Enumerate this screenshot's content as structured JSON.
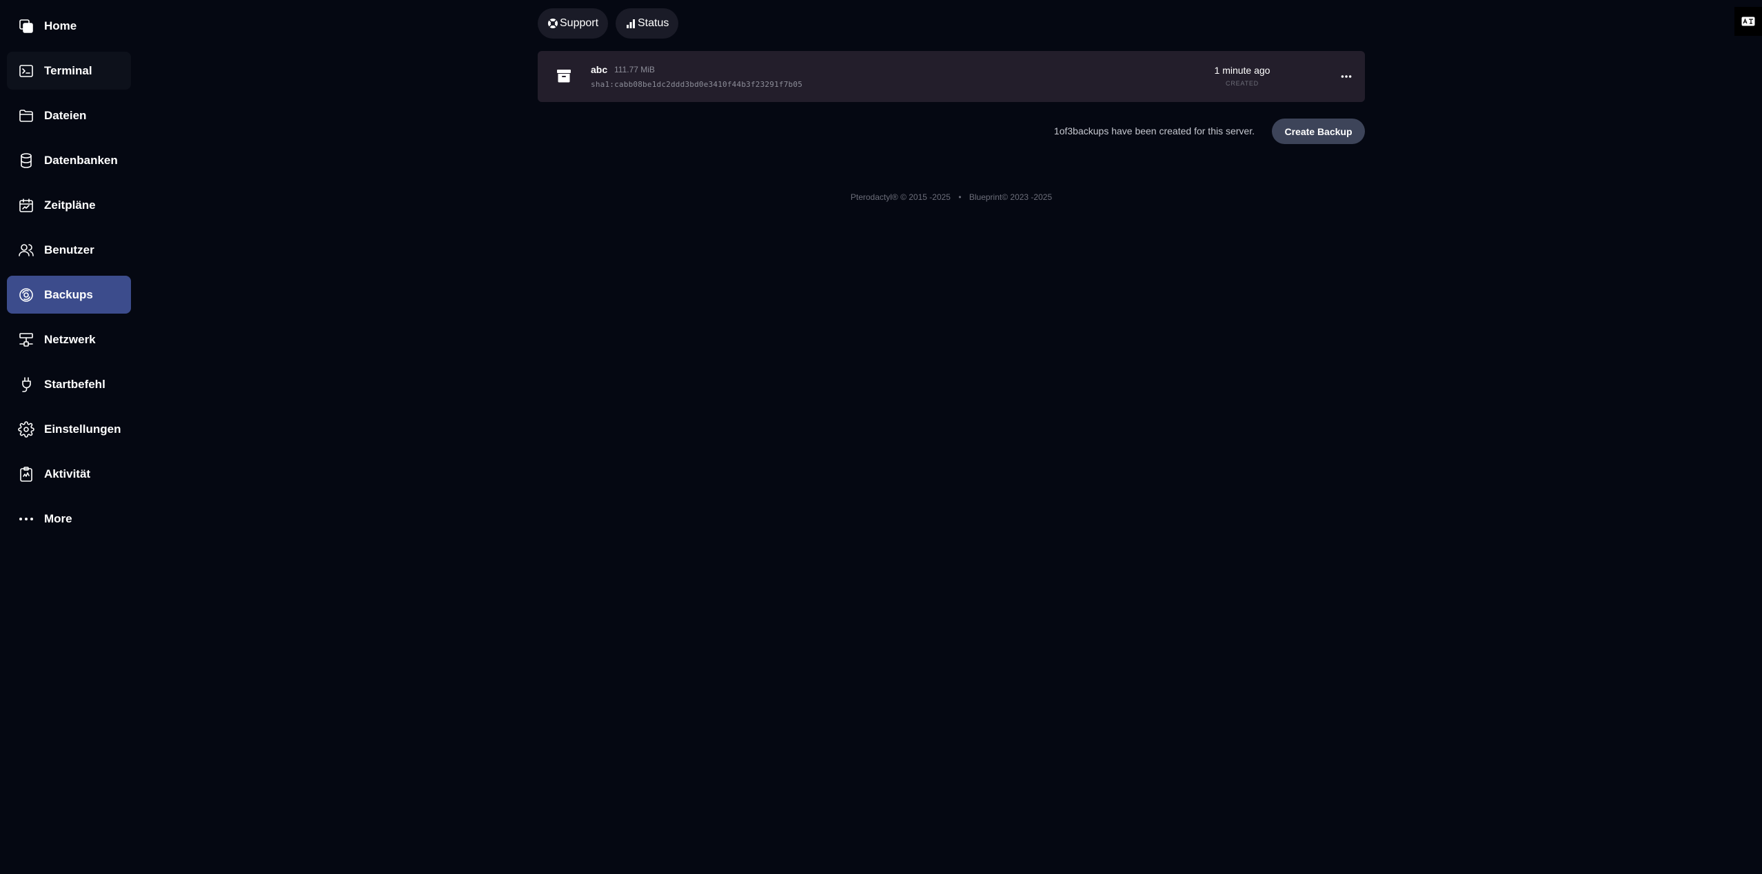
{
  "sidebar": {
    "items": [
      {
        "label": "Home",
        "icon": "home-icon"
      },
      {
        "label": "Terminal",
        "icon": "terminal-icon"
      },
      {
        "label": "Dateien",
        "icon": "folder-icon"
      },
      {
        "label": "Datenbanken",
        "icon": "database-icon"
      },
      {
        "label": "Zeitpläne",
        "icon": "calendar-icon"
      },
      {
        "label": "Benutzer",
        "icon": "users-icon"
      },
      {
        "label": "Backups",
        "icon": "backup-icon"
      },
      {
        "label": "Netzwerk",
        "icon": "network-icon"
      },
      {
        "label": "Startbefehl",
        "icon": "plug-icon"
      },
      {
        "label": "Einstellungen",
        "icon": "gear-icon"
      },
      {
        "label": "Aktivität",
        "icon": "clipboard-icon"
      },
      {
        "label": "More",
        "icon": "more-icon"
      }
    ],
    "active_item": "Backups",
    "hovered_item": "Terminal"
  },
  "top_buttons": {
    "support_label": "Support",
    "status_label": "Status"
  },
  "backup": {
    "name": "abc",
    "size": "111.77 MiB",
    "checksum": "sha1:cabb08be1dc2ddd3bd0e3410f44b3f23291f7b05",
    "time": "1 minute ago",
    "time_caption": "CREATED"
  },
  "quota_text": "1of3backups have been created for this server.",
  "create_button_label": "Create Backup",
  "footer": {
    "pterodactyl": "Pterodactyl® © 2015 -2025",
    "separator": "•",
    "blueprint": "Blueprint© 2023 -2025"
  },
  "colors": {
    "background": "#050812",
    "active_nav": "#3c4c8c",
    "card": "#231e2b",
    "create_button": "#3d4459"
  }
}
